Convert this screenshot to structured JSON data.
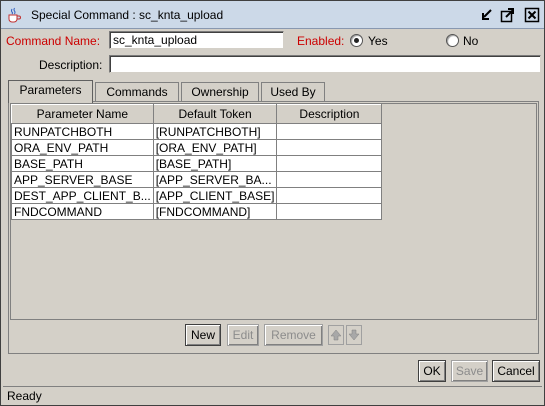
{
  "window": {
    "title": "Special Command : sc_knta_upload"
  },
  "form": {
    "command_name_label": "Command Name:",
    "command_name_value": "sc_knta_upload",
    "enabled_label": "Enabled:",
    "enabled_yes": "Yes",
    "enabled_no": "No",
    "enabled_selected": "Yes",
    "description_label": "Description:",
    "description_value": ""
  },
  "tabs": [
    {
      "label": "Parameters",
      "active": true
    },
    {
      "label": "Commands",
      "active": false
    },
    {
      "label": "Ownership",
      "active": false
    },
    {
      "label": "Used By",
      "active": false
    }
  ],
  "table": {
    "headers": [
      "Parameter Name",
      "Default Token",
      "Description"
    ],
    "rows": [
      [
        "RUNPATCHBOTH",
        "[RUNPATCHBOTH]",
        ""
      ],
      [
        "ORA_ENV_PATH",
        "[ORA_ENV_PATH]",
        ""
      ],
      [
        "BASE_PATH",
        "[BASE_PATH]",
        ""
      ],
      [
        "APP_SERVER_BASE",
        "[APP_SERVER_BA...",
        ""
      ],
      [
        "DEST_APP_CLIENT_B...",
        "[APP_CLIENT_BASE]",
        ""
      ],
      [
        "FNDCOMMAND",
        "[FNDCOMMAND]",
        ""
      ]
    ]
  },
  "table_buttons": {
    "new": "New",
    "edit": "Edit",
    "remove": "Remove"
  },
  "dialog_buttons": {
    "ok": "OK",
    "save": "Save",
    "cancel": "Cancel"
  },
  "status": {
    "text": "Ready"
  },
  "icons": {
    "app": "java-cup-icon",
    "minimize": "minimize-icon",
    "maximize": "maximize-icon",
    "close": "close-icon",
    "move_up": "arrow-up-icon",
    "move_down": "arrow-down-icon"
  },
  "colors": {
    "required_label": "#cc0000",
    "titlebar": "#ccd9e8",
    "dialog_bg": "#d4d0c8"
  }
}
